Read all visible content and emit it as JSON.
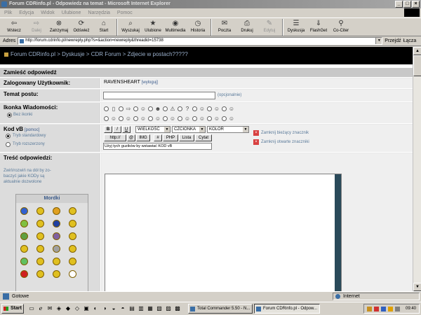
{
  "window": {
    "title": "Forum CDRinfo.pl - Odpowiedz na temat - Microsoft Internet Explorer"
  },
  "menu": [
    "Plik",
    "Edycja",
    "Widok",
    "Ulubione",
    "Narzędzia",
    "Pomoc"
  ],
  "toolbar": [
    {
      "label": "Wstecz",
      "icon": "back-arrow-icon",
      "glyph": "⇦",
      "disabled": false
    },
    {
      "label": "Dalej",
      "icon": "forward-arrow-icon",
      "glyph": "⇨",
      "disabled": true
    },
    {
      "label": "Zatrzymaj",
      "icon": "stop-icon",
      "glyph": "⊗",
      "disabled": false
    },
    {
      "label": "Odśwież",
      "icon": "refresh-icon",
      "glyph": "⟳",
      "disabled": false
    },
    {
      "label": "Start",
      "icon": "home-icon",
      "glyph": "⌂",
      "disabled": false
    },
    {
      "label": "Wyszukaj",
      "icon": "search-icon",
      "glyph": "⌕",
      "disabled": false
    },
    {
      "label": "Ulubione",
      "icon": "favorites-icon",
      "glyph": "★",
      "disabled": false
    },
    {
      "label": "Multimedia",
      "icon": "media-icon",
      "glyph": "◉",
      "disabled": false
    },
    {
      "label": "Historia",
      "icon": "history-icon",
      "glyph": "◷",
      "disabled": false
    },
    {
      "label": "Poczta",
      "icon": "mail-icon",
      "glyph": "✉",
      "disabled": false
    },
    {
      "label": "Drukuj",
      "icon": "print-icon",
      "glyph": "⎙",
      "disabled": false
    },
    {
      "label": "Edytuj",
      "icon": "edit-icon",
      "glyph": "✎",
      "disabled": true
    },
    {
      "label": "Dyskusja",
      "icon": "discuss-icon",
      "glyph": "☰",
      "disabled": false
    },
    {
      "label": "FlashGet",
      "icon": "flashget-icon",
      "glyph": "⇓",
      "disabled": false
    },
    {
      "label": "Co-Citer",
      "icon": "cociter-icon",
      "glyph": "⚲",
      "disabled": false
    }
  ],
  "address": {
    "label": "Adres",
    "url": "http://forum.cdrinfo.pl/newreply.php?s=&action=newreply&threadid=15738",
    "go_label": "Przejdź",
    "links_label": "Łącza"
  },
  "page": {
    "breadcrumb": "Forum CDRinfo.pl > Dyskusje > CDR Forum > Zdjecie w postach?????",
    "section_title": "Zamieść odpowiedź",
    "logged_label": "Zalogowany Użytkownik:",
    "username": "RAVENSHEART",
    "logout_link": "[wyloguj]",
    "topic_label": "Temat postu:",
    "optional": "(opcjonalnie)",
    "icon_label": "Ikonka Wiadomości:",
    "no_icon": "Bez ikonki",
    "vbcode_label": "Kod vB",
    "help_link": "[pomoc]",
    "mode_standard": "Tryb standardowy",
    "mode_extended": "Tryb rozszerzony",
    "fmt_buttons": [
      "B",
      "I",
      "U"
    ],
    "size_select": "WIELKOŚĆ",
    "font_select": "CZCIONKA",
    "color_select": "KOLOR",
    "tag_buttons": [
      "http://",
      "@",
      "IMG",
      "#",
      "PHP",
      "Lista",
      "Cytat"
    ],
    "close_current": "Zamknij bieżący znacznik",
    "close_all": "Zamknij otwarte znaczniki",
    "helper_text": "Użyj tych guzików by wstawiać KOD vB",
    "content_label": "Treść odpowiedzi:",
    "content_hint": "Zwiń/rozwiń na dół by zo-baczyć jakie KODy są aktualnie dozwolone",
    "smilies_title": "Mordki"
  },
  "status": {
    "text": "Gotowe",
    "zone": "Internet"
  },
  "taskbar": {
    "start": "Start",
    "tasks": [
      "Total Commander 5.50 - N...",
      "Forum CDRinfo.pl - Odpow..."
    ],
    "clock": "09:40"
  },
  "colors": {
    "breadcrumb_bg": "#000000",
    "link": "#5a7a9a",
    "form_bg": "#e8e8e8"
  }
}
